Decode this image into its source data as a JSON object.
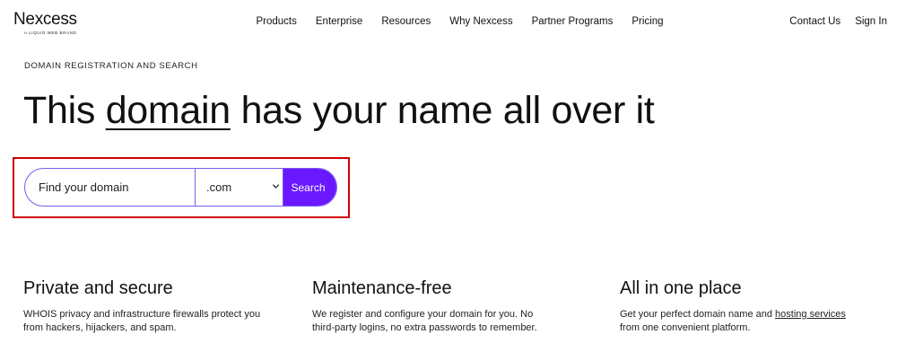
{
  "brand": {
    "name": "Nexcess",
    "tagline": "A LIQUID WEB BRAND"
  },
  "nav": {
    "center": [
      "Products",
      "Enterprise",
      "Resources",
      "Why Nexcess",
      "Partner Programs",
      "Pricing"
    ],
    "right": [
      "Contact Us",
      "Sign In"
    ]
  },
  "hero": {
    "eyebrow": "DOMAIN REGISTRATION AND SEARCH",
    "headline_before": "This ",
    "headline_link": "domain",
    "headline_after": " has your name all over it"
  },
  "search": {
    "placeholder": "Find your domain",
    "tld_selected": ".com",
    "button_label": "Search",
    "colors": {
      "accent": "#6a18ff",
      "highlight_border": "#d00000"
    }
  },
  "features": [
    {
      "title": "Private and secure",
      "line1": "WHOIS privacy and infrastructure firewalls protect you",
      "line2": "from hackers, hijackers, and spam."
    },
    {
      "title": "Maintenance-free",
      "line1": "We register and configure your domain for you. No",
      "line2": "third-party logins, no extra passwords to remember."
    },
    {
      "title": "All in one place",
      "line1_before": "Get your perfect domain name and ",
      "line1_link": "hosting services",
      "line2": "from one convenient platform."
    }
  ]
}
